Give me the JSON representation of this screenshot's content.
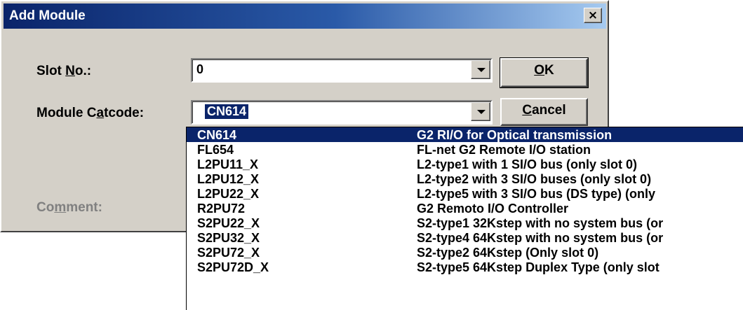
{
  "window": {
    "title": "Add Module",
    "close_glyph": "×"
  },
  "slot": {
    "label_pre": "Slot ",
    "label_mnemonic": "N",
    "label_post": "o.:",
    "value": "0"
  },
  "catcode": {
    "label_pre": "Module C",
    "label_mnemonic": "a",
    "label_post": "tcode:",
    "value": "CN614"
  },
  "comment": {
    "label_pre": "Co",
    "label_mnemonic": "m",
    "label_post": "ment:"
  },
  "buttons": {
    "ok_mnemonic": "O",
    "ok_rest": "K",
    "cancel_mnemonic": "C",
    "cancel_rest": "ancel"
  },
  "dropdown": {
    "selected_index": 0,
    "items": [
      {
        "code": "CN614",
        "desc": "G2 RI/O for Optical transmission"
      },
      {
        "code": "FL654",
        "desc": "FL-net G2 Remote I/O station"
      },
      {
        "code": "L2PU11_X",
        "desc": "L2-type1 with 1 SI/O bus (only slot 0)"
      },
      {
        "code": "L2PU12_X",
        "desc": "L2-type2 with 3 SI/O buses (only slot 0)"
      },
      {
        "code": "L2PU22_X",
        "desc": "L2-type5 with 3 SI/O bus (DS type) (only"
      },
      {
        "code": "R2PU72",
        "desc": "G2 Remoto I/O Controller"
      },
      {
        "code": "S2PU22_X",
        "desc": "S2-type1 32Kstep with no system bus (or"
      },
      {
        "code": "S2PU32_X",
        "desc": "S2-type4 64Kstep with no system bus (or"
      },
      {
        "code": "S2PU72_X",
        "desc": "S2-type2 64Kstep (Only slot 0)"
      },
      {
        "code": "S2PU72D_X",
        "desc": "S2-type5 64Kstep Duplex Type (only slot"
      }
    ]
  },
  "colors": {
    "face": "#d4d0c8",
    "title_active": "#0a246a",
    "selection": "#0a246a",
    "disabled_text": "#808080"
  }
}
